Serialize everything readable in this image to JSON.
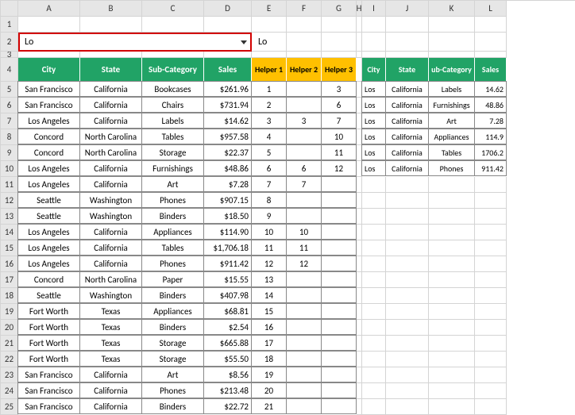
{
  "search": {
    "value": "Lo",
    "echo": "Lo"
  },
  "col_letters": [
    "A",
    "B",
    "C",
    "D",
    "E",
    "F",
    "G",
    "H",
    "I",
    "J",
    "K",
    "L"
  ],
  "row_numbers": [
    "1",
    "2",
    "3",
    "4",
    "5",
    "6",
    "7",
    "8",
    "9",
    "10",
    "11",
    "12",
    "13",
    "14",
    "15",
    "16",
    "17",
    "18",
    "19",
    "20",
    "21",
    "22",
    "23",
    "24",
    "25"
  ],
  "headers_main": [
    "City",
    "State",
    "Sub-Category",
    "Sales",
    "Helper 1",
    "Helper 2",
    "Helper 3"
  ],
  "headers_right": [
    "City",
    "State",
    "ub-Category",
    "Sales"
  ],
  "rows_main": [
    {
      "city": "San Francisco",
      "state": "California",
      "sub": "Bookcases",
      "sales": "$261.96",
      "h1": "1",
      "h2": "",
      "h3": "3"
    },
    {
      "city": "San Francisco",
      "state": "California",
      "sub": "Chairs",
      "sales": "$731.94",
      "h1": "2",
      "h2": "",
      "h3": "6"
    },
    {
      "city": "Los Angeles",
      "state": "California",
      "sub": "Labels",
      "sales": "$14.62",
      "h1": "3",
      "h2": "3",
      "h3": "7"
    },
    {
      "city": "Concord",
      "state": "North Carolina",
      "sub": "Tables",
      "sales": "$957.58",
      "h1": "4",
      "h2": "",
      "h3": "10"
    },
    {
      "city": "Concord",
      "state": "North Carolina",
      "sub": "Storage",
      "sales": "$22.37",
      "h1": "5",
      "h2": "",
      "h3": "11"
    },
    {
      "city": "Los Angeles",
      "state": "California",
      "sub": "Furnishings",
      "sales": "$48.86",
      "h1": "6",
      "h2": "6",
      "h3": "12"
    },
    {
      "city": "Los Angeles",
      "state": "California",
      "sub": "Art",
      "sales": "$7.28",
      "h1": "7",
      "h2": "7",
      "h3": ""
    },
    {
      "city": "Seattle",
      "state": "Washington",
      "sub": "Phones",
      "sales": "$907.15",
      "h1": "8",
      "h2": "",
      "h3": ""
    },
    {
      "city": "Seattle",
      "state": "Washington",
      "sub": "Binders",
      "sales": "$18.50",
      "h1": "9",
      "h2": "",
      "h3": ""
    },
    {
      "city": "Los Angeles",
      "state": "California",
      "sub": "Appliances",
      "sales": "$114.90",
      "h1": "10",
      "h2": "10",
      "h3": ""
    },
    {
      "city": "Los Angeles",
      "state": "California",
      "sub": "Tables",
      "sales": "$1,706.18",
      "h1": "11",
      "h2": "11",
      "h3": ""
    },
    {
      "city": "Los Angeles",
      "state": "California",
      "sub": "Phones",
      "sales": "$911.42",
      "h1": "12",
      "h2": "12",
      "h3": ""
    },
    {
      "city": "Concord",
      "state": "North Carolina",
      "sub": "Paper",
      "sales": "$15.55",
      "h1": "13",
      "h2": "",
      "h3": ""
    },
    {
      "city": "Seattle",
      "state": "Washington",
      "sub": "Binders",
      "sales": "$407.98",
      "h1": "14",
      "h2": "",
      "h3": ""
    },
    {
      "city": "Fort Worth",
      "state": "Texas",
      "sub": "Appliances",
      "sales": "$68.81",
      "h1": "15",
      "h2": "",
      "h3": ""
    },
    {
      "city": "Fort Worth",
      "state": "Texas",
      "sub": "Binders",
      "sales": "$2.54",
      "h1": "16",
      "h2": "",
      "h3": ""
    },
    {
      "city": "Fort Worth",
      "state": "Texas",
      "sub": "Storage",
      "sales": "$665.88",
      "h1": "17",
      "h2": "",
      "h3": ""
    },
    {
      "city": "Fort Worth",
      "state": "Texas",
      "sub": "Storage",
      "sales": "$55.50",
      "h1": "18",
      "h2": "",
      "h3": ""
    },
    {
      "city": "San Francisco",
      "state": "California",
      "sub": "Art",
      "sales": "$8.56",
      "h1": "19",
      "h2": "",
      "h3": ""
    },
    {
      "city": "San Francisco",
      "state": "California",
      "sub": "Phones",
      "sales": "$213.48",
      "h1": "20",
      "h2": "",
      "h3": ""
    },
    {
      "city": "San Francisco",
      "state": "California",
      "sub": "Binders",
      "sales": "$22.72",
      "h1": "21",
      "h2": "",
      "h3": ""
    }
  ],
  "rows_right": [
    {
      "city": "Los",
      "state": "California",
      "sub": "Labels",
      "sales": "14.62"
    },
    {
      "city": "Los",
      "state": "California",
      "sub": "Furnishings",
      "sales": "48.86"
    },
    {
      "city": "Los",
      "state": "California",
      "sub": "Art",
      "sales": "7.28"
    },
    {
      "city": "Los",
      "state": "California",
      "sub": "Appliances",
      "sales": "114.9"
    },
    {
      "city": "Los",
      "state": "California",
      "sub": "Tables",
      "sales": "1706.2"
    },
    {
      "city": "Los",
      "state": "California",
      "sub": "Phones",
      "sales": "911.42"
    }
  ]
}
